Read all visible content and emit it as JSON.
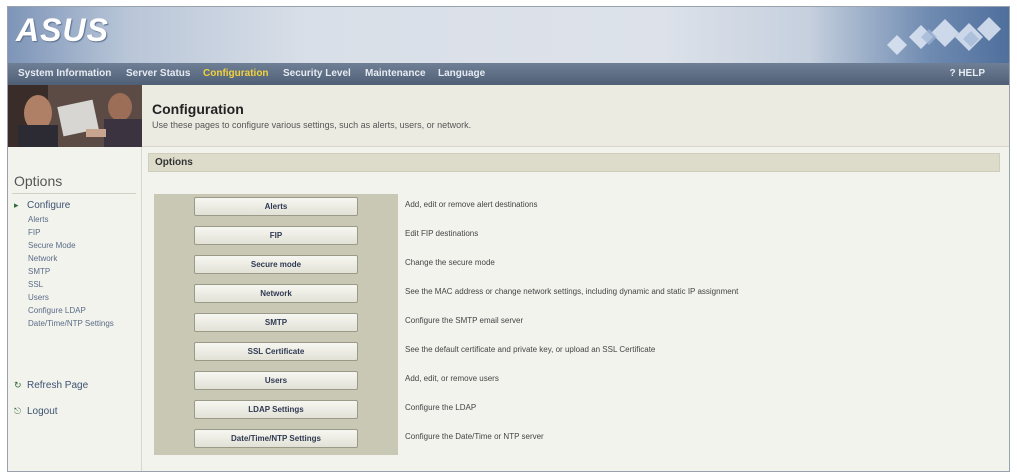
{
  "brand": {
    "logo": "ASUS",
    "tagline": "",
    "banner_caption": ""
  },
  "nav": {
    "items": [
      {
        "label": "System Information",
        "active": false
      },
      {
        "label": "Server Status",
        "active": false
      },
      {
        "label": "Configuration",
        "active": true
      },
      {
        "label": "Security Level",
        "active": false
      },
      {
        "label": "Maintenance",
        "active": false
      },
      {
        "label": "Language",
        "active": false
      }
    ],
    "help": "? HELP"
  },
  "page": {
    "title": "Configuration",
    "description": "Use these pages to configure various settings, such as alerts, users, or network."
  },
  "sidebar": {
    "title": "Options",
    "configure": "Configure",
    "sub_items": [
      "Alerts",
      "FIP",
      "Secure Mode",
      "Network",
      "SMTP",
      "SSL",
      "Users",
      "Configure LDAP",
      "Date/Time/NTP Settings"
    ],
    "refresh": "Refresh Page",
    "logout": "Logout"
  },
  "options": {
    "header": "Options",
    "rows": [
      {
        "button": "Alerts",
        "desc": "Add, edit or remove alert destinations"
      },
      {
        "button": "FIP",
        "desc": "Edit FIP destinations"
      },
      {
        "button": "Secure mode",
        "desc": "Change the secure mode"
      },
      {
        "button": "Network",
        "desc": "See the MAC address or change network settings, including dynamic and static IP assignment"
      },
      {
        "button": "SMTP",
        "desc": "Configure the SMTP email server"
      },
      {
        "button": "SSL Certificate",
        "desc": "See the default certificate and private key, or upload an SSL Certificate"
      },
      {
        "button": "Users",
        "desc": "Add, edit, or remove users"
      },
      {
        "button": "LDAP Settings",
        "desc": "Configure the LDAP"
      },
      {
        "button": "Date/Time/NTP Settings",
        "desc": "Configure the Date/Time or NTP server"
      }
    ]
  },
  "colors": {
    "nav_bg": "#56657c",
    "nav_active": "#f2d23c",
    "panel": "#c9c8b4",
    "options_bar": "#dddccb"
  }
}
